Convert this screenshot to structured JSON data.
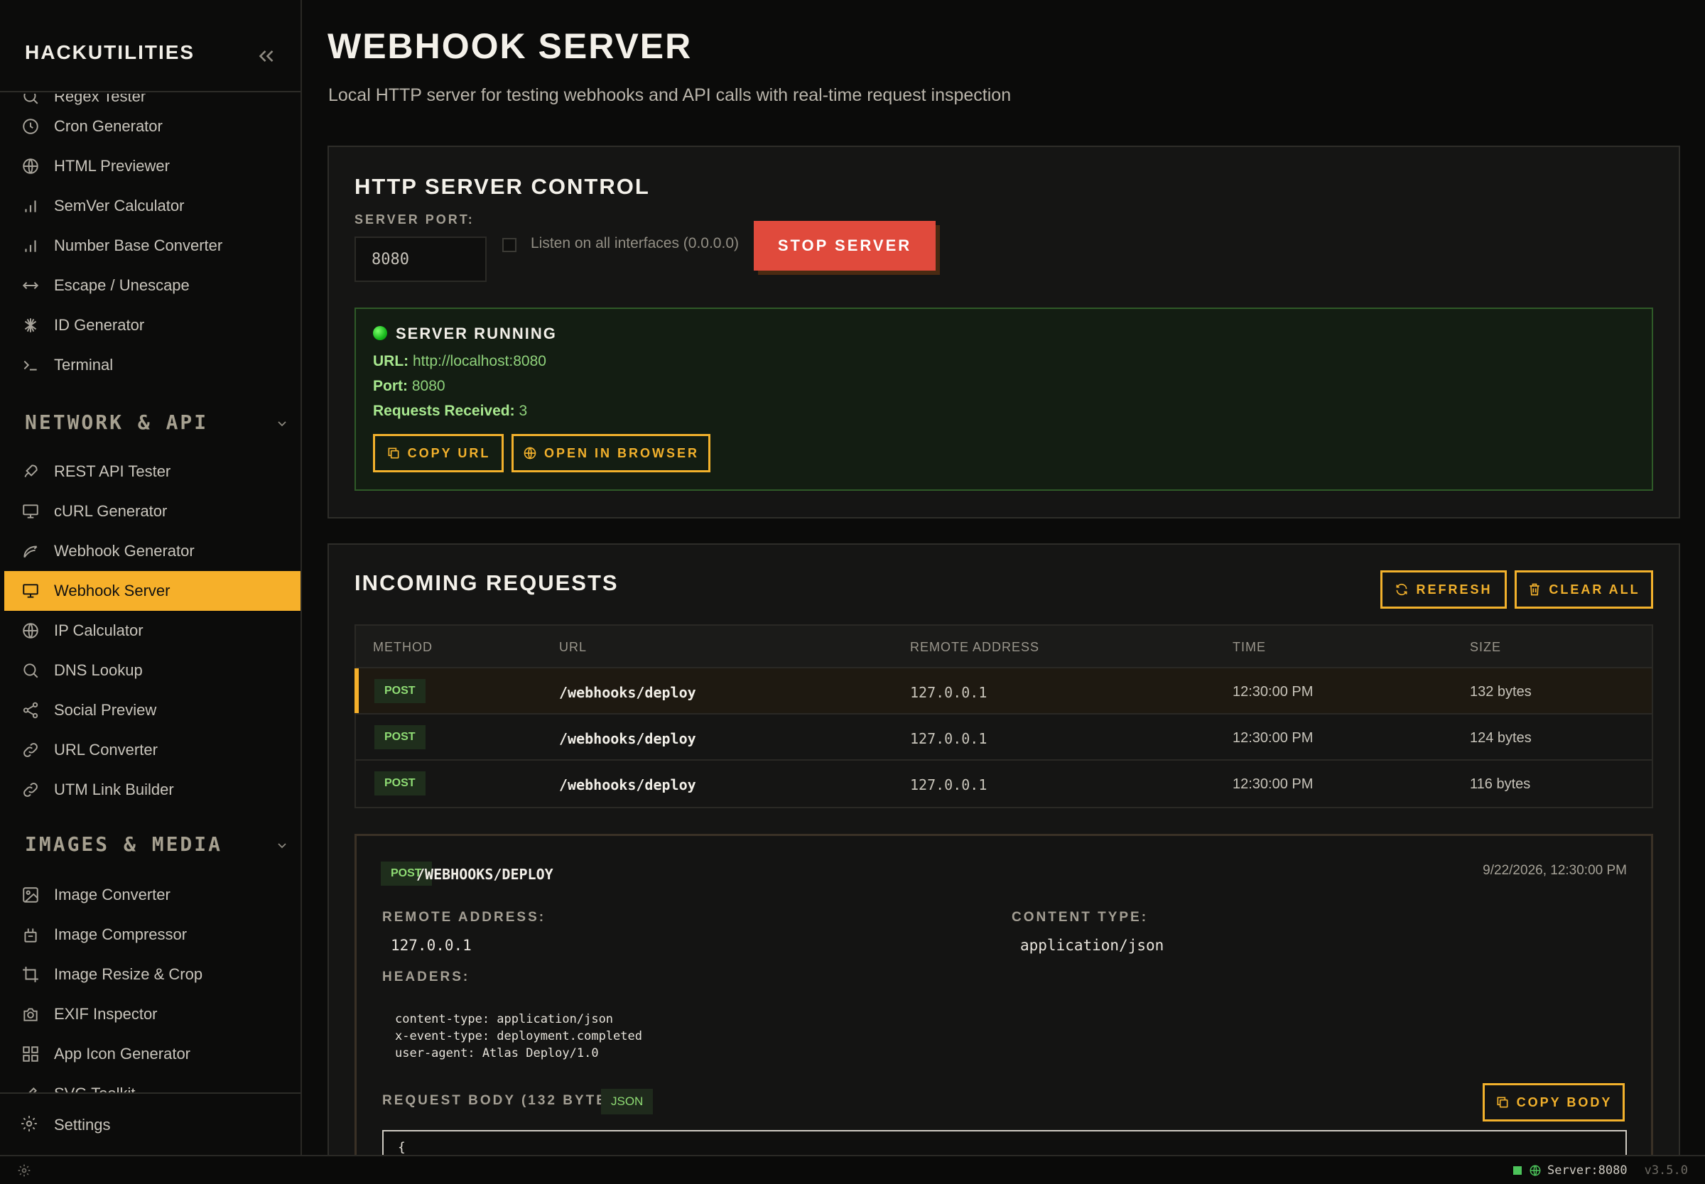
{
  "app": {
    "brand": "HACKUTILITIES"
  },
  "sidebar": {
    "partial_top_item": "Regex Tester",
    "items_dev": [
      {
        "label": "Cron Generator",
        "icon": "clock-icon"
      },
      {
        "label": "HTML Previewer",
        "icon": "globe-icon"
      },
      {
        "label": "SemVer Calculator",
        "icon": "bar-chart-icon"
      },
      {
        "label": "Number Base Converter",
        "icon": "bar-chart-icon"
      },
      {
        "label": "Escape / Unescape",
        "icon": "arrows-horizontal-icon"
      },
      {
        "label": "ID Generator",
        "icon": "spark-icon"
      },
      {
        "label": "Terminal",
        "icon": "terminal-icon"
      }
    ],
    "section_network": "NETWORK & API",
    "items_network": [
      {
        "label": "REST API Tester",
        "icon": "rocket-icon"
      },
      {
        "label": "cURL Generator",
        "icon": "monitor-icon"
      },
      {
        "label": "Webhook Generator",
        "icon": "webhook-icon"
      },
      {
        "label": "Webhook Server",
        "icon": "monitor-icon",
        "active": true
      },
      {
        "label": "IP Calculator",
        "icon": "globe-icon"
      },
      {
        "label": "DNS Lookup",
        "icon": "search-icon"
      },
      {
        "label": "Social Preview",
        "icon": "share-icon"
      },
      {
        "label": "URL Converter",
        "icon": "link-icon"
      },
      {
        "label": "UTM Link Builder",
        "icon": "link-icon"
      }
    ],
    "section_media": "IMAGES & MEDIA",
    "items_media": [
      {
        "label": "Image Converter",
        "icon": "image-icon"
      },
      {
        "label": "Image Compressor",
        "icon": "compress-icon"
      },
      {
        "label": "Image Resize & Crop",
        "icon": "crop-icon"
      },
      {
        "label": "EXIF Inspector",
        "icon": "camera-icon"
      },
      {
        "label": "App Icon Generator",
        "icon": "grid-icon"
      },
      {
        "label": "SVG Toolkit",
        "icon": "pen-icon"
      }
    ],
    "settings_label": "Settings"
  },
  "page": {
    "title": "WEBHOOK SERVER",
    "subtitle": "Local HTTP server for testing webhooks and API calls with real-time request inspection"
  },
  "server_control": {
    "title": "HTTP SERVER CONTROL",
    "port_label": "SERVER PORT:",
    "port_value": "8080",
    "listen_all_label": "Listen on all interfaces (0.0.0.0)",
    "listen_all_checked": false,
    "stop_button": "STOP SERVER",
    "status_title": "SERVER RUNNING",
    "url_label": "URL:",
    "url_value": "http://localhost:8080",
    "port_line_label": "Port:",
    "port_line_value": "8080",
    "requests_label": "Requests Received:",
    "requests_value": "3",
    "copy_url_button": "COPY URL",
    "open_browser_button": "OPEN IN BROWSER"
  },
  "incoming": {
    "title": "INCOMING REQUESTS",
    "refresh_button": "REFRESH",
    "clear_button": "CLEAR ALL",
    "columns": [
      "METHOD",
      "URL",
      "REMOTE ADDRESS",
      "TIME",
      "SIZE"
    ],
    "rows": [
      {
        "method": "POST",
        "url": "/webhooks/deploy",
        "remote": "127.0.0.1",
        "time": "12:30:00 PM",
        "size": "132 bytes",
        "selected": true
      },
      {
        "method": "POST",
        "url": "/webhooks/deploy",
        "remote": "127.0.0.1",
        "time": "12:30:00 PM",
        "size": "124 bytes"
      },
      {
        "method": "POST",
        "url": "/webhooks/deploy",
        "remote": "127.0.0.1",
        "time": "12:30:00 PM",
        "size": "116 bytes"
      }
    ]
  },
  "detail": {
    "method": "POST",
    "path": "/WEBHOOKS/DEPLOY",
    "timestamp": "9/22/2026, 12:30:00 PM",
    "remote_label": "REMOTE ADDRESS:",
    "remote_value": "127.0.0.1",
    "content_type_label": "CONTENT TYPE:",
    "content_type_value": "application/json",
    "headers_label": "HEADERS:",
    "headers_text": "content-type: application/json\nx-event-type: deployment.completed\nuser-agent: Atlas Deploy/1.0",
    "body_label": "REQUEST BODY (132 BYTES):",
    "body_format": "JSON",
    "copy_body_button": "COPY BODY",
    "body_preview": "{"
  },
  "statusbar": {
    "server": "Server:8080",
    "version": "v3.5.0"
  },
  "colors": {
    "accent": "#f6b02a",
    "danger": "#e04a3c",
    "success": "#4cc35a",
    "background": "#0b0b0a"
  }
}
